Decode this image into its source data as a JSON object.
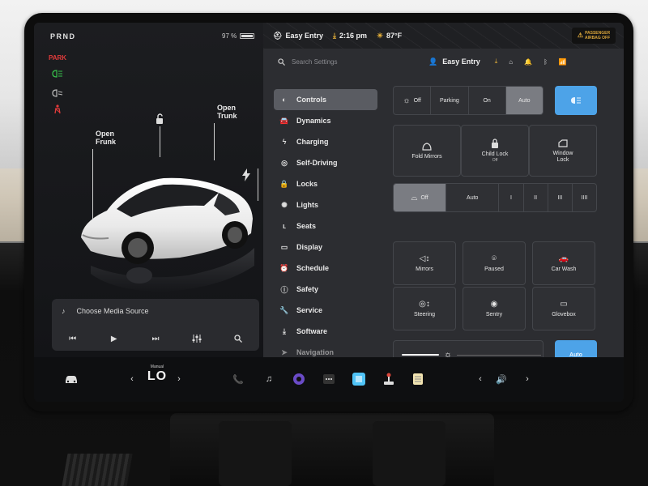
{
  "status": {
    "gear": "PRND",
    "battery": "97 %",
    "battery_fraction": 0.97,
    "park_label": "PARK"
  },
  "car_labels": {
    "frunk_line1": "Open",
    "frunk_line2": "Frunk",
    "trunk_line1": "Open",
    "trunk_line2": "Trunk"
  },
  "media": {
    "source_label": "Choose Media Source"
  },
  "topbar": {
    "profile": "Easy Entry",
    "time": "2:16 pm",
    "temp": "87°F",
    "airbag_line1": "PASSENGER",
    "airbag_line2": "AIRBAG OFF"
  },
  "search": {
    "placeholder": "Search Settings",
    "profile": "Easy Entry"
  },
  "nav": {
    "items": [
      {
        "label": "Controls",
        "icon": "toggle-icon"
      },
      {
        "label": "Dynamics",
        "icon": "car-icon"
      },
      {
        "label": "Charging",
        "icon": "bolt-icon"
      },
      {
        "label": "Self-Driving",
        "icon": "steering-wheel-icon"
      },
      {
        "label": "Locks",
        "icon": "lock-icon"
      },
      {
        "label": "Lights",
        "icon": "bulb-icon"
      },
      {
        "label": "Seats",
        "icon": "seat-icon"
      },
      {
        "label": "Display",
        "icon": "display-icon"
      },
      {
        "label": "Schedule",
        "icon": "alarm-icon"
      },
      {
        "label": "Safety",
        "icon": "alert-icon"
      },
      {
        "label": "Service",
        "icon": "wrench-icon"
      },
      {
        "label": "Software",
        "icon": "download-icon"
      },
      {
        "label": "Navigation",
        "icon": "navigation-icon"
      }
    ]
  },
  "controls": {
    "lights_seg": [
      "Off",
      "Parking",
      "On",
      "Auto"
    ],
    "mirrors_card": "Fold Mirrors",
    "child_lock_card": "Child Lock",
    "child_lock_sub": "Off",
    "window_lock_card_line1": "Window",
    "window_lock_card_line2": "Lock",
    "wiper_seg": [
      "Off",
      "Auto",
      "I",
      "II",
      "III",
      "IIII"
    ],
    "tiles": [
      "Mirrors",
      "Paused",
      "Car Wash",
      "Steering",
      "Sentry",
      "Glovebox"
    ],
    "auto_button": "Auto"
  },
  "dock": {
    "temp_mode": "Manual",
    "temp_value": "LO"
  }
}
